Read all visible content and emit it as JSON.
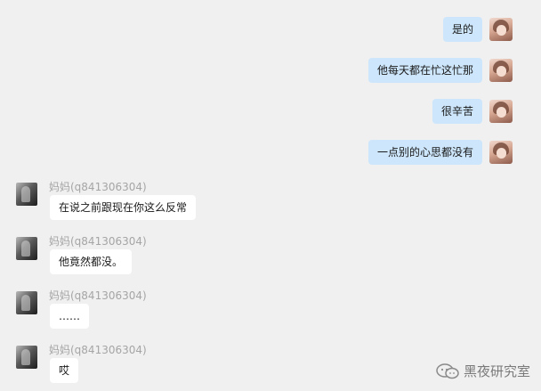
{
  "outgoing": [
    {
      "text": "是的"
    },
    {
      "text": "他每天都在忙这忙那"
    },
    {
      "text": "很辛苦"
    },
    {
      "text": "一点别的心思都没有"
    }
  ],
  "incoming": [
    {
      "sender": "妈妈(q841306304)",
      "text": "在说之前跟现在你这么反常"
    },
    {
      "sender": "妈妈(q841306304)",
      "text": "他竟然都没。"
    },
    {
      "sender": "妈妈(q841306304)",
      "text": "……"
    },
    {
      "sender": "妈妈(q841306304)",
      "text": "哎"
    }
  ],
  "watermark": {
    "text": "黑夜研究室",
    "icon": "wechat-icon"
  }
}
